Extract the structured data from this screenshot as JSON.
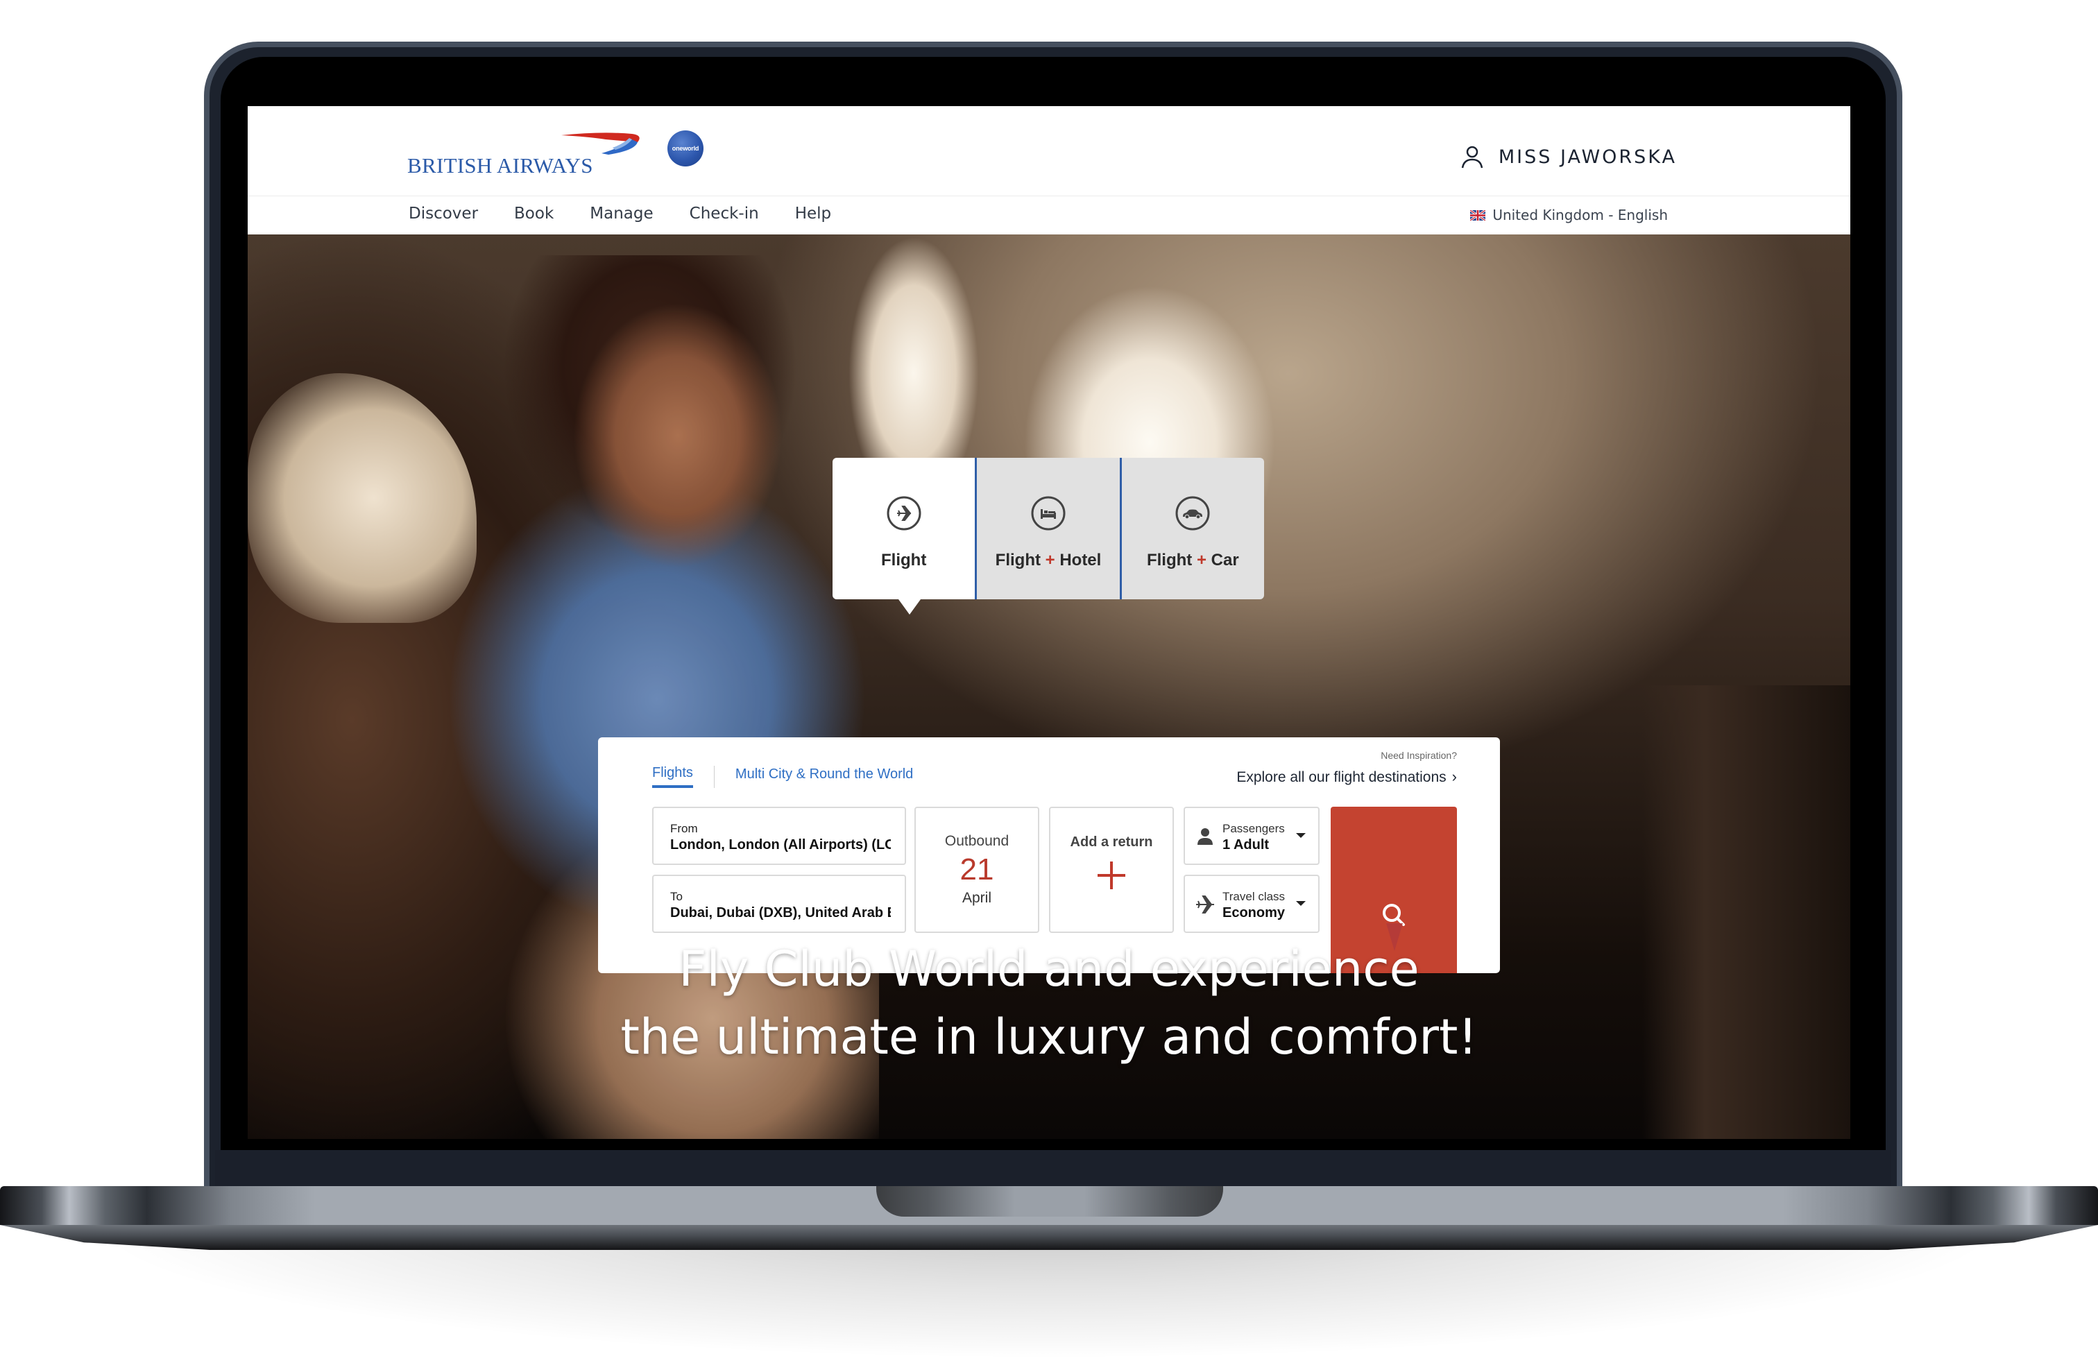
{
  "device": {
    "type": "laptop-mockup"
  },
  "header": {
    "brand": "BRITISH AIRWAYS",
    "alliance_badge": "oneworld",
    "user_name": "MISS JAWORSKA"
  },
  "nav": {
    "items": [
      {
        "label": "Discover"
      },
      {
        "label": "Book"
      },
      {
        "label": "Manage"
      },
      {
        "label": "Check-in"
      },
      {
        "label": "Help"
      }
    ],
    "locale": "United Kingdom - English"
  },
  "booking_tabs": [
    {
      "label_main": "Flight",
      "plus": "",
      "label_extra": "",
      "icon": "flight-icon",
      "active": true
    },
    {
      "label_main": "Flight ",
      "plus": "+",
      "label_extra": " Hotel",
      "icon": "hotel-bed-icon",
      "active": false
    },
    {
      "label_main": "Flight ",
      "plus": "+",
      "label_extra": " Car",
      "icon": "car-icon",
      "active": false
    }
  ],
  "search": {
    "subtabs": [
      {
        "label": "Flights",
        "active": true
      },
      {
        "label": "Multi City & Round the World",
        "active": false
      }
    ],
    "inspiration_prompt": "Need Inspiration?",
    "inspiration_link": "Explore all our flight destinations",
    "from": {
      "label": "From",
      "value": "London, London (All Airports) (LON)"
    },
    "to": {
      "label": "To",
      "value": "Dubai, Dubai (DXB), United Arab Emirates"
    },
    "outbound": {
      "label": "Outbound",
      "day": "21",
      "month": "April"
    },
    "return": {
      "label": "Add a return"
    },
    "passengers": {
      "label": "Passengers",
      "value": "1 Adult"
    },
    "travel_class": {
      "label": "Travel class",
      "value": "Economy"
    },
    "search_button_icon": "search-icon"
  },
  "hero": {
    "headline_line1": "Fly Club World and experience",
    "headline_line2": "the ultimate in luxury and comfort!"
  },
  "colors": {
    "brand_blue": "#2b5aa8",
    "link_blue": "#2f6fc4",
    "accent_red": "#c44330",
    "date_red": "#b93a2c"
  }
}
